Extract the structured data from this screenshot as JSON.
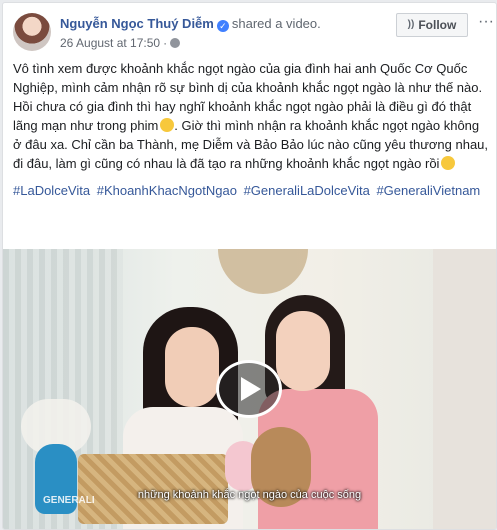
{
  "post": {
    "author": "Nguyễn Ngọc Thuý Diễm",
    "action": "shared a video.",
    "date": "26 August at 17:50",
    "meta_separator": "·",
    "follow_label": "Follow",
    "more_glyph": "···",
    "text": "Vô tình xem được khoảnh khắc ngọt ngào của gia đình hai anh Quốc Cơ Quốc Nghiệp, mình cảm nhận rõ sự bình dị của khoảnh khắc ngọt ngào là như thế nào. Hồi chưa có gia đình thì hay nghĩ khoảnh khắc ngọt ngào phải là điều gì đó thật lãng mạn như trong phim",
    "text2": ". Giờ thì mình nhận ra khoảnh khắc ngọt ngào không ở đâu xa. Chỉ cần ba Thành, mẹ Diễm và Bảo Bảo lúc nào cũng yêu thương nhau, đi đâu, làm gì cũng có nhau là đã tạo ra những khoảnh khắc ngọt ngào rồi",
    "hashtags": [
      "#LaDolceVita",
      "#KhoanhKhacNgotNgao",
      "#GeneraliLaDolceVita",
      "#GeneraliVietnam"
    ]
  },
  "video": {
    "subtitle": "những khoảnh khắc ngọt ngào của cuộc sống",
    "watermark": "GENERALI"
  },
  "colors": {
    "link": "#365899",
    "text": "#1c1e21",
    "verified": "#4080ff"
  }
}
